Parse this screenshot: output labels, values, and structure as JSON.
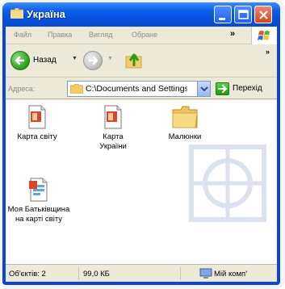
{
  "window": {
    "title": "Україна",
    "title_icon": "folder-icon",
    "buttons": [
      "minimize-icon",
      "maximize-icon",
      "close-icon"
    ]
  },
  "menu": {
    "items": [
      "Файл",
      "Правка",
      "Вигляд",
      "Обране"
    ],
    "overflow": "»"
  },
  "toolbar": {
    "back_label": "Назад",
    "dropdown": "▼",
    "overflow": "»"
  },
  "address": {
    "label": "Адреса:",
    "value": "C:\\Documents and Settings",
    "go_label": "Перехід"
  },
  "items": [
    {
      "label_lines": [
        "Карта світу"
      ],
      "icon": "powerpoint-file-icon"
    },
    {
      "label_lines": [
        "Карта",
        "України"
      ],
      "icon": "powerpoint-file-icon"
    },
    {
      "label_lines": [
        "Малюнки"
      ],
      "icon": "folder-icon"
    },
    {
      "label_lines": [
        "Моя Батьківщина",
        "на карті світу"
      ],
      "icon": "publisher-file-icon"
    }
  ],
  "status": {
    "objects": "Об'єктів: 2",
    "size": "99,0 КБ",
    "location": "Мій комп'"
  },
  "colors": {
    "titlebar": "#0a46d8",
    "chrome": "#ece9d8",
    "content": "#ffffff"
  }
}
